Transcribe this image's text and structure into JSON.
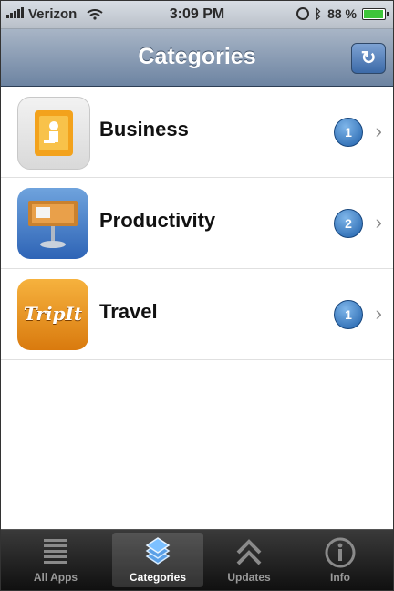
{
  "status": {
    "carrier": "Verizon",
    "time": "3:09 PM",
    "battery": "88 %",
    "battery_level": 0.88
  },
  "nav": {
    "title": "Categories",
    "refresh_icon": "refresh-icon"
  },
  "categories": [
    {
      "label": "Business",
      "badge": "1",
      "icon": "business-app-icon"
    },
    {
      "label": "Productivity",
      "badge": "2",
      "icon": "keynote-app-icon"
    },
    {
      "label": "Travel",
      "badge": "1",
      "icon": "tripit-app-icon"
    }
  ],
  "travel_icon_text": "TripIt",
  "tabs": [
    {
      "label": "All Apps",
      "icon": "list-icon",
      "active": false
    },
    {
      "label": "Categories",
      "icon": "layers-icon",
      "active": true
    },
    {
      "label": "Updates",
      "icon": "chevrons-up-icon",
      "active": false
    },
    {
      "label": "Info",
      "icon": "info-icon",
      "active": false
    }
  ],
  "colors": {
    "nav_bar": "#6d84a2",
    "badge": "#1e5fa9",
    "tab_bar": "#101010"
  }
}
